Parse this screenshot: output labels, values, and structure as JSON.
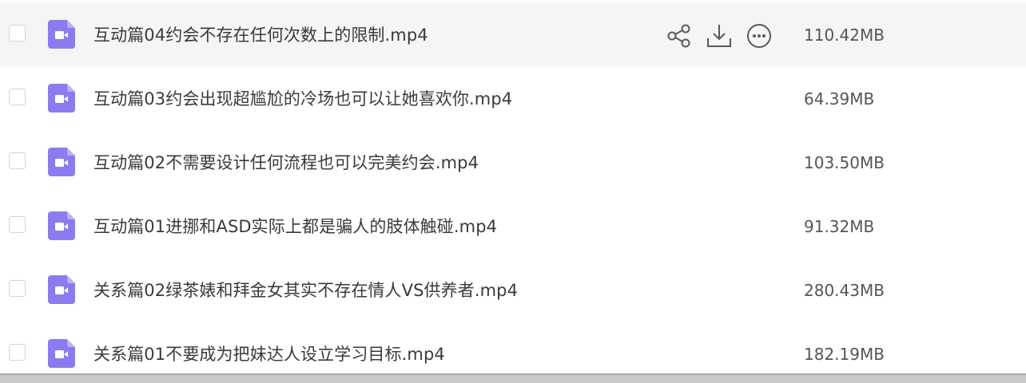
{
  "files": [
    {
      "name": "互动篇04约会不存在任何次数上的限制.mp4",
      "size": "110.42MB",
      "hovered": true
    },
    {
      "name": "互动篇03约会出现超尴尬的冷场也可以让她喜欢你.mp4",
      "size": "64.39MB"
    },
    {
      "name": "互动篇02不需要设计任何流程也可以完美约会.mp4",
      "size": "103.50MB"
    },
    {
      "name": "互动篇01进挪和ASD实际上都是骗人的肢体触碰.mp4",
      "size": "91.32MB"
    },
    {
      "name": "关系篇02绿茶婊和拜金女其实不存在情人VS供养者.mp4",
      "size": "280.43MB"
    },
    {
      "name": "关系篇01不要成为把妹达人设立学习目标.mp4",
      "size": "182.19MB"
    }
  ],
  "icons": {
    "file": "video-file-icon",
    "share": "share-icon",
    "download": "download-icon",
    "more": "more-icon"
  },
  "colors": {
    "file_icon": "#8a7cf0",
    "row_hover": "#f5f5f6",
    "action_icon": "#5a5a5a"
  }
}
